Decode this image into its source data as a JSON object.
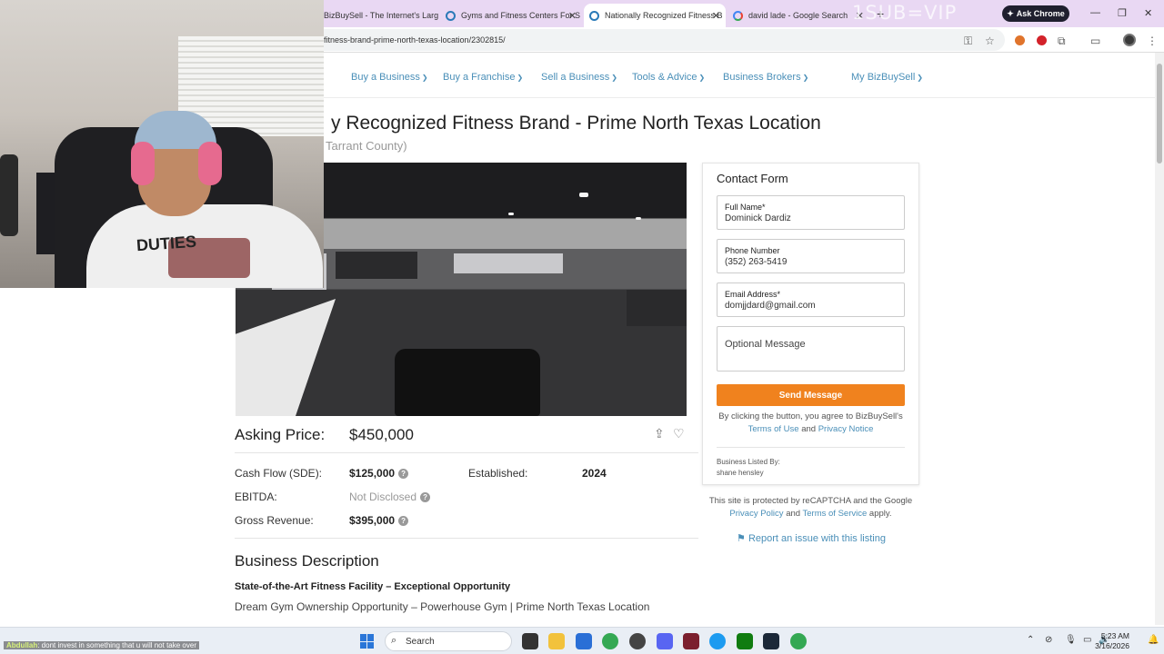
{
  "browser": {
    "tabs": [
      {
        "label": "BizBuySell - The Internet's Larg",
        "active": false
      },
      {
        "label": "Gyms and Fitness Centers For S",
        "active": false
      },
      {
        "label": "Nationally Recognized Fitness B",
        "active": true
      },
      {
        "label": "david lade - Google Search",
        "active": false
      }
    ],
    "overlay_text": "1SUB=VIP",
    "ask_chrome_label": "Ask Chrome",
    "url": "fitness-brand-prime-north-texas-location/2302815/"
  },
  "site_nav": {
    "items": [
      "Buy a Business",
      "Buy a Franchise",
      "Sell a Business",
      "Tools & Advice",
      "Business Brokers"
    ],
    "account": "My BizBuySell"
  },
  "listing": {
    "title": "y Recognized Fitness Brand - Prime North Texas Location",
    "location": "Tarrant County)",
    "asking_label": "Asking Price:",
    "asking_value": "$450,000",
    "financials": {
      "cash_flow_label": "Cash Flow (SDE):",
      "cash_flow_value": "$125,000",
      "established_label": "Established:",
      "established_value": "2024",
      "ebitda_label": "EBITDA:",
      "ebitda_value": "Not Disclosed",
      "revenue_label": "Gross Revenue:",
      "revenue_value": "$395,000"
    },
    "description_heading": "Business Description",
    "description_subheading": "State-of-the-Art Fitness Facility – Exceptional Opportunity",
    "description_line": "Dream Gym Ownership Opportunity – Powerhouse Gym | Prime North Texas Location"
  },
  "contact_form": {
    "title": "Contact Form",
    "full_name_label": "Full Name*",
    "full_name_value": "Dominick Dardiz",
    "phone_label": "Phone Number",
    "phone_value": "(352) 263-5419",
    "email_label": "Email Address*",
    "email_value": "domjjdard@gmail.com",
    "message_placeholder": "Optional Message",
    "send_label": "Send Message",
    "terms_prefix": "By clicking the button, you agree to BizBuySell's",
    "terms_link": "Terms of Use",
    "terms_and": "and",
    "privacy_link": "Privacy Notice",
    "listed_by_label": "Business Listed By:",
    "listed_by_name": "shane hensley"
  },
  "recaptcha": {
    "line1": "This site is protected by reCAPTCHA and the Google",
    "privacy_link": "Privacy Policy",
    "and": "and",
    "terms_link": "Terms of Service",
    "apply": "apply."
  },
  "report_link": "Report an issue with this listing",
  "stream_chat": {
    "user": "Abdullah",
    "message": ": dont invest in something that u will not take over"
  },
  "webcam_shirt_text": "DUTIES",
  "taskbar": {
    "search_label": "Search",
    "time": "5:23 AM",
    "date": "3/16/2026"
  },
  "colors": {
    "accent_link": "#4a8fb8",
    "send_button": "#f0821e",
    "tab_strip": "#e9d8f3"
  }
}
